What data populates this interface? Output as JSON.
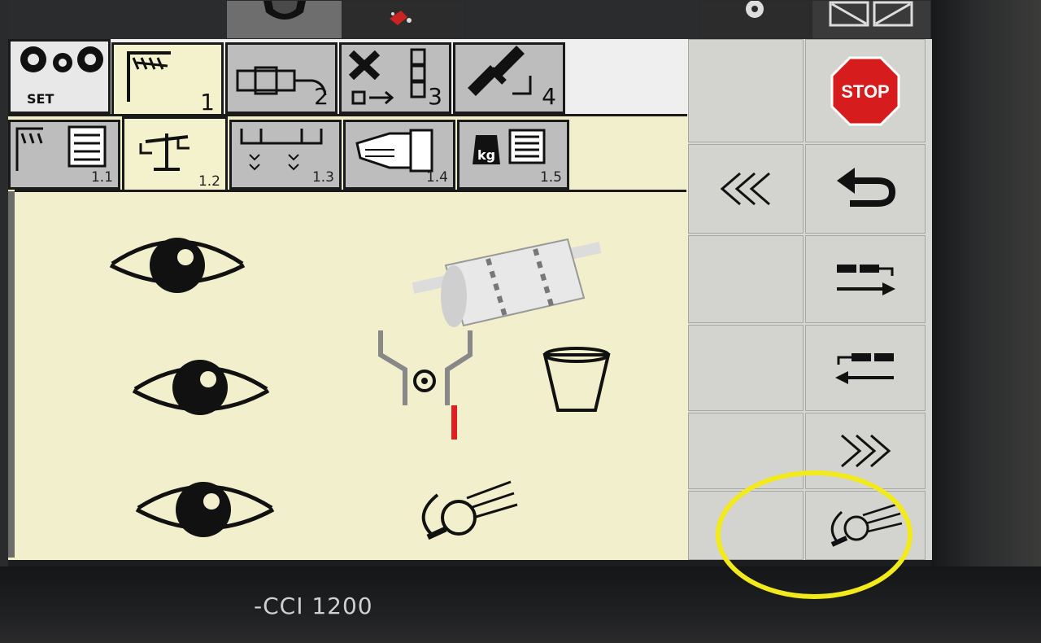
{
  "device": {
    "model": "-CCI 1200"
  },
  "tabs": [
    {
      "id": "set",
      "label": "SET"
    },
    {
      "id": "crop",
      "number": "1"
    },
    {
      "id": "sensor",
      "number": "2"
    },
    {
      "id": "tools",
      "number": "3"
    },
    {
      "id": "gps",
      "number": "4"
    }
  ],
  "subtabs": [
    {
      "id": "crop-list",
      "number": "1.1"
    },
    {
      "id": "scale",
      "number": "1.2"
    },
    {
      "id": "bins",
      "number": "1.3"
    },
    {
      "id": "manual",
      "number": "1.4"
    },
    {
      "id": "weight",
      "number": "1.5",
      "unit": "kg"
    }
  ],
  "softkeys": {
    "stop_label": "STOP",
    "icons": [
      "stop-icon",
      "rewind-icon",
      "back-arrow-icon",
      "shift-right-icon",
      "shift-left-icon",
      "forward-icon",
      "calibrate-spinner-icon"
    ]
  },
  "content_rows": [
    {
      "visible": "eye-icon",
      "item": "roller-icon"
    },
    {
      "visible": "eye-icon",
      "item": "hopper-gear-icon",
      "extra": "cup-icon"
    },
    {
      "visible": "eye-icon",
      "item": "calibrate-spinner-icon"
    }
  ],
  "colors": {
    "screen_bg": "#f2f0cc",
    "stop_red": "#d61c1c",
    "indicator_red": "#e02020",
    "highlight": "#f3ea1b"
  }
}
